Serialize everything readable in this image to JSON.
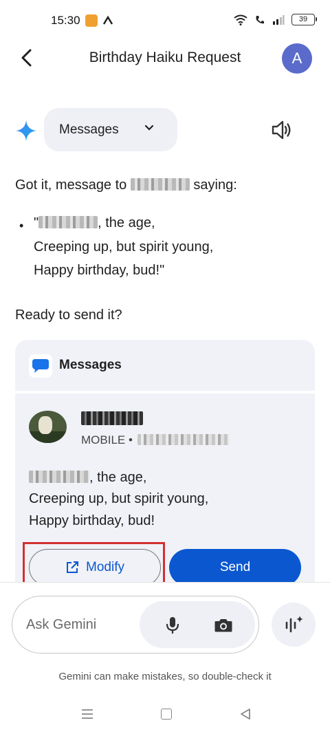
{
  "status_bar": {
    "time": "15:30",
    "battery": "39"
  },
  "header": {
    "title": "Birthday Haiku Request",
    "avatar_initial": "A"
  },
  "app_chip": {
    "label": "Messages"
  },
  "response": {
    "intro_prefix": "Got it, message to",
    "intro_suffix": "saying:",
    "bullet": "•",
    "haiku_line1_prefix": "\"",
    "haiku_line1_suffix": ", the age,",
    "haiku_line2": "Creeping up, but spirit young,",
    "haiku_line3": "Happy birthday, bud!\"",
    "question": "Ready to send it?"
  },
  "card": {
    "app_label": "Messages",
    "contact_type": "MOBILE •",
    "message_line1_suffix": ", the age,",
    "message_line2": "Creeping up, but spirit young,",
    "message_line3": "Happy birthday, bud!",
    "modify_label": "Modify",
    "send_label": "Send"
  },
  "input": {
    "placeholder": "Ask Gemini",
    "disclaimer": "Gemini can make mistakes, so double-check it"
  },
  "colors": {
    "accent_blue": "#0b57d0",
    "avatar_bg": "#5b6bcb",
    "highlight_red": "#d32f2f",
    "card_bg": "#f0f2f8"
  },
  "icons": [
    "back-arrow-icon",
    "gemini-sparkle-icon",
    "chevron-down-icon",
    "speaker-icon",
    "messages-app-icon",
    "open-external-icon",
    "mic-icon",
    "camera-icon",
    "live-sparkle-icon",
    "wifi-icon",
    "call-icon",
    "signal-icon",
    "battery-icon"
  ]
}
